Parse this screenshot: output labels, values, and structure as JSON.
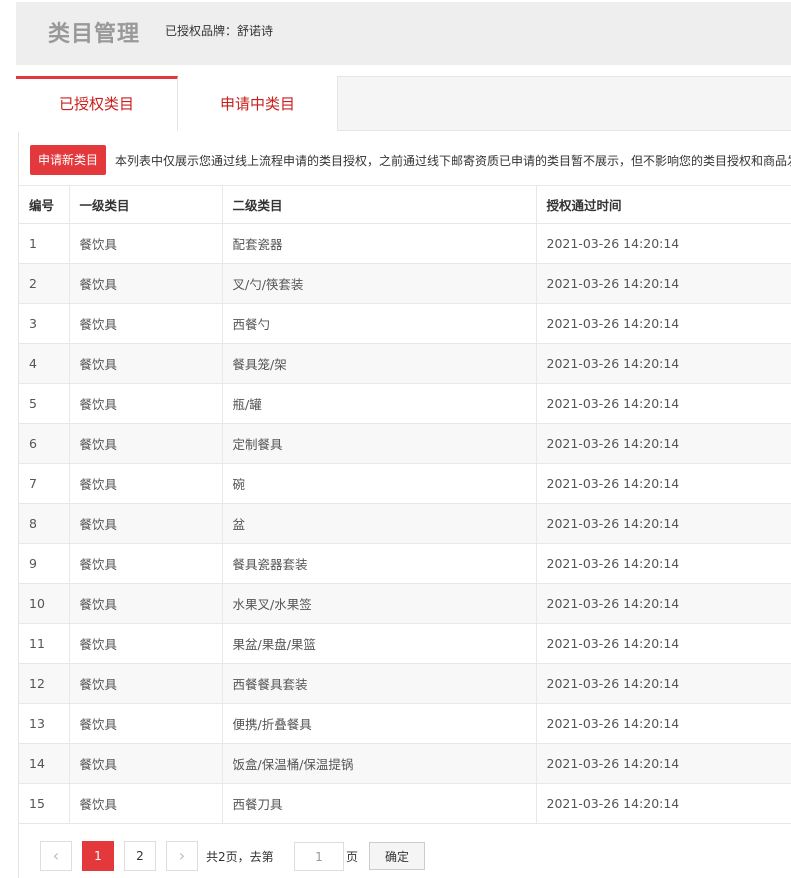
{
  "header": {
    "title": "类目管理",
    "brand_label": "已授权品牌：舒诺诗"
  },
  "tabs": [
    {
      "label": "已授权类目",
      "active": true
    },
    {
      "label": "申请中类目",
      "active": false
    }
  ],
  "toolbar": {
    "apply_button": "申请新类目",
    "notice": "本列表中仅展示您通过线上流程申请的类目授权，之前通过线下邮寄资质已申请的类目暂不展示，但不影响您的类目授权和商品发"
  },
  "table": {
    "columns": [
      "编号",
      "一级类目",
      "二级类目",
      "授权通过时间"
    ],
    "rows": [
      [
        "1",
        "餐饮具",
        "配套瓷器",
        "2021-03-26 14:20:14"
      ],
      [
        "2",
        "餐饮具",
        "叉/勺/筷套装",
        "2021-03-26 14:20:14"
      ],
      [
        "3",
        "餐饮具",
        "西餐勺",
        "2021-03-26 14:20:14"
      ],
      [
        "4",
        "餐饮具",
        "餐具笼/架",
        "2021-03-26 14:20:14"
      ],
      [
        "5",
        "餐饮具",
        "瓶/罐",
        "2021-03-26 14:20:14"
      ],
      [
        "6",
        "餐饮具",
        "定制餐具",
        "2021-03-26 14:20:14"
      ],
      [
        "7",
        "餐饮具",
        "碗",
        "2021-03-26 14:20:14"
      ],
      [
        "8",
        "餐饮具",
        "盆",
        "2021-03-26 14:20:14"
      ],
      [
        "9",
        "餐饮具",
        "餐具瓷器套装",
        "2021-03-26 14:20:14"
      ],
      [
        "10",
        "餐饮具",
        "水果叉/水果签",
        "2021-03-26 14:20:14"
      ],
      [
        "11",
        "餐饮具",
        "果盆/果盘/果篮",
        "2021-03-26 14:20:14"
      ],
      [
        "12",
        "餐饮具",
        "西餐餐具套装",
        "2021-03-26 14:20:14"
      ],
      [
        "13",
        "餐饮具",
        "便携/折叠餐具",
        "2021-03-26 14:20:14"
      ],
      [
        "14",
        "餐饮具",
        "饭盒/保温桶/保温提锅",
        "2021-03-26 14:20:14"
      ],
      [
        "15",
        "餐饮具",
        "西餐刀具",
        "2021-03-26 14:20:14"
      ]
    ]
  },
  "pagination": {
    "prev_icon": "‹",
    "next_icon": "›",
    "pages": [
      "1",
      "2"
    ],
    "current_page": "1",
    "total_text": "共2页，去第",
    "goto_value": "1",
    "page_suffix": "页",
    "confirm_label": "确定"
  },
  "colors": {
    "accent": "#e4393c",
    "tab_text": "#c9201e"
  }
}
